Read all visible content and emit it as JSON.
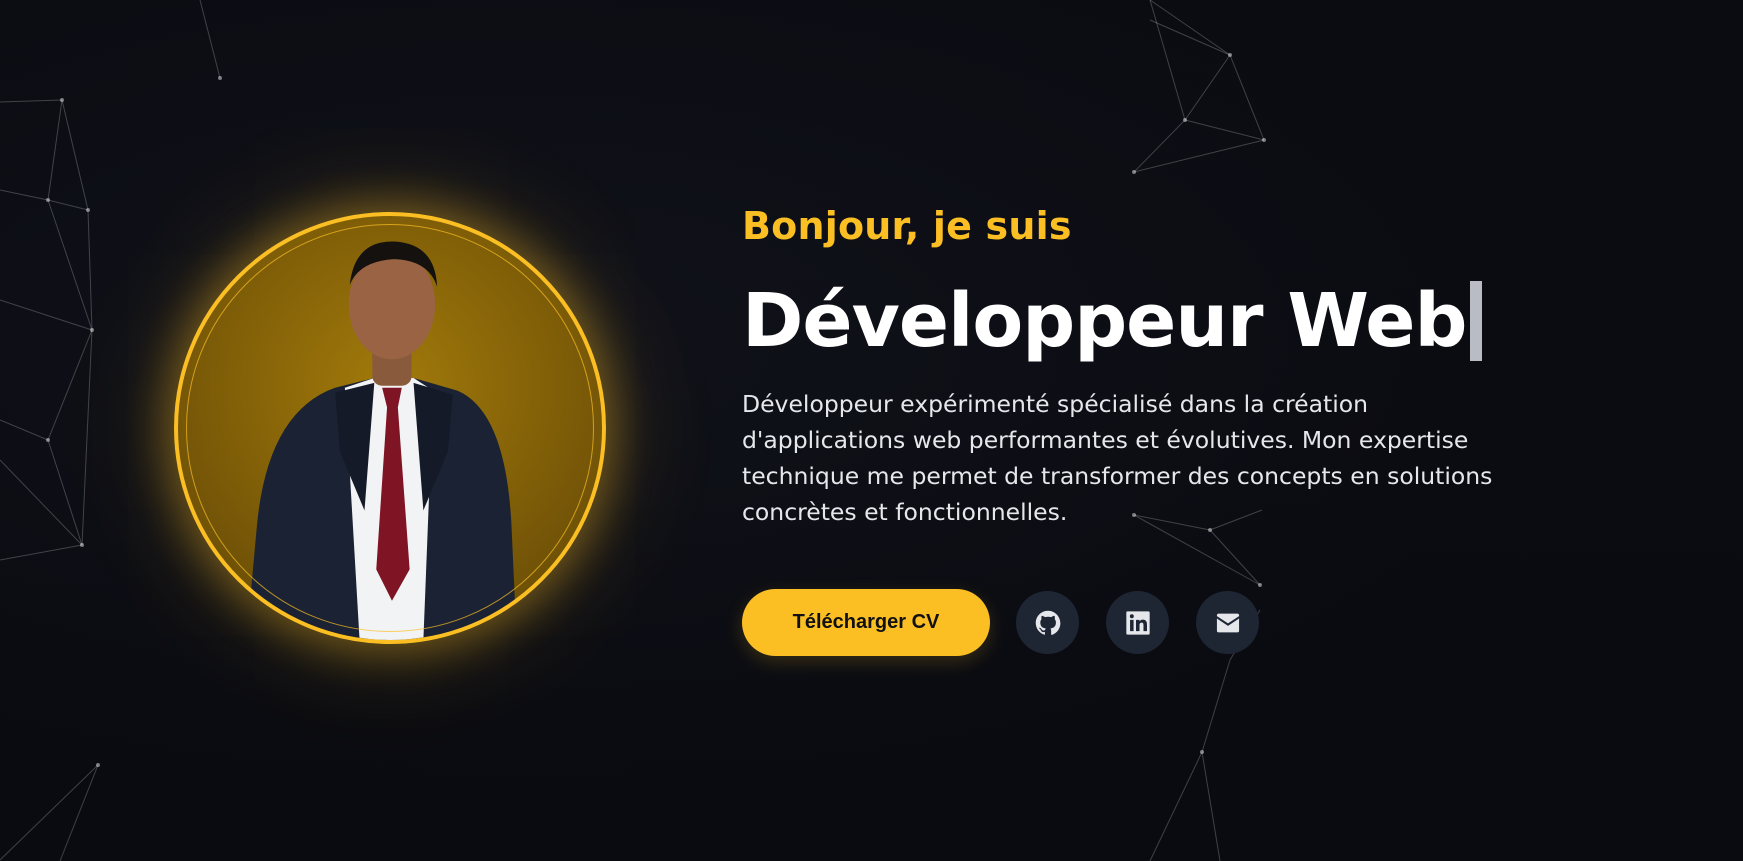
{
  "hero": {
    "greeting": "Bonjour, je suis",
    "title": "Développeur Web",
    "description": "Développeur expérimenté spécialisé dans la création d'applications web performantes et évolutives. Mon expertise technique me permet de transformer des concepts en solutions concrètes et fonctionnelles."
  },
  "actions": {
    "download_cv_label": "Télécharger CV",
    "social_links": [
      {
        "icon": "github-icon"
      },
      {
        "icon": "linkedin-icon"
      },
      {
        "icon": "mail-icon"
      }
    ]
  },
  "colors": {
    "accent": "#fbbf24",
    "background": "#0a0b10",
    "social_button_bg": "#1e2533",
    "text_primary": "#ffffff",
    "text_secondary": "#e5e7eb"
  }
}
